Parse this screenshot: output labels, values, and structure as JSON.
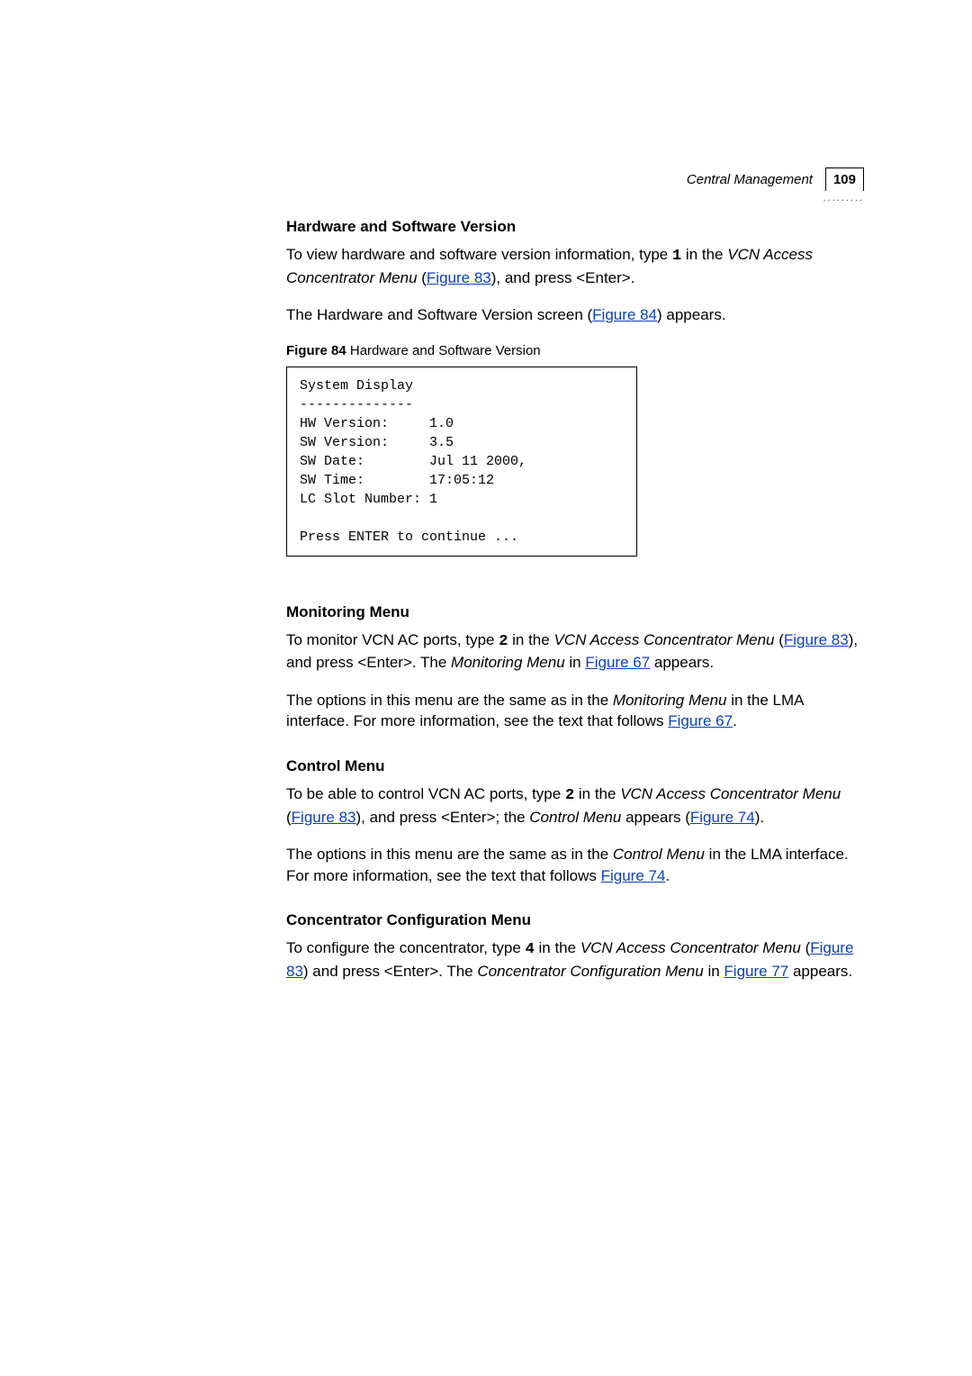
{
  "header": {
    "section": "Central Management",
    "page_num": "109",
    "dots": "........."
  },
  "sec1": {
    "heading": "Hardware and Software Version",
    "para1_pre": "To view hardware and software version information, type ",
    "para1_mono": "1",
    "para1_mid": " in the ",
    "para1_ital": "VCN Access Concentrator Menu",
    "para1_open": " (",
    "para1_link": "Figure 83",
    "para1_post": "), and press <Enter>.",
    "para2_pre": "The Hardware and Software Version screen (",
    "para2_link": "Figure 84",
    "para2_post": ") appears."
  },
  "fig84": {
    "label": "Figure 84",
    "caption_rest": "   Hardware and Software Version",
    "code": "System Display\n--------------\nHW Version:     1.0\nSW Version:     3.5\nSW Date:        Jul 11 2000,\nSW Time:        17:05:12\nLC Slot Number: 1\n\nPress ENTER to continue ...\n"
  },
  "sec2": {
    "heading": "Monitoring Menu",
    "p1_a": "To monitor VCN AC ports, type ",
    "p1_mono": "2",
    "p1_b": " in the ",
    "p1_ital": "VCN Access Concentrator Menu",
    "p1_c": " (",
    "p1_link1": "Figure 83",
    "p1_d": "), and press <Enter>. The ",
    "p1_ital2": "Monitoring Menu",
    "p1_e": " in ",
    "p1_link2": "Figure 67",
    "p1_f": " appears.",
    "p2_a": "The options in this menu are the same as in the ",
    "p2_ital": "Monitoring Menu",
    "p2_b": " in the LMA interface. For more information, see the text that follows ",
    "p2_link": "Figure 67",
    "p2_c": "."
  },
  "sec3": {
    "heading": "Control Menu",
    "p1_a": "To be able to control VCN AC ports, type ",
    "p1_mono": "2",
    "p1_b": " in the ",
    "p1_ital": "VCN Access Concentrator Menu",
    "p1_c": " (",
    "p1_link1": "Figure 83",
    "p1_d": "), and press <Enter>; the ",
    "p1_ital2": "Control Menu",
    "p1_e": " appears (",
    "p1_link2": "Figure 74",
    "p1_f": ").",
    "p2_a": "The options in this menu are the same as in the ",
    "p2_ital": "Control Menu",
    "p2_b": " in the LMA interface. For more information, see the text that follows ",
    "p2_link": "Figure 74",
    "p2_c": "."
  },
  "sec4": {
    "heading": "Concentrator Configuration Menu",
    "p1_a": "To configure the concentrator, type ",
    "p1_mono": "4",
    "p1_b": " in the ",
    "p1_ital": "VCN Access Concentrator Menu",
    "p1_c": " (",
    "p1_link1": "Figure 83",
    "p1_d": ") and press <Enter>. The ",
    "p1_ital2": "Concentrator Configuration Menu",
    "p1_e": " in ",
    "p1_link2": "Figure 77",
    "p1_f": " appears."
  }
}
